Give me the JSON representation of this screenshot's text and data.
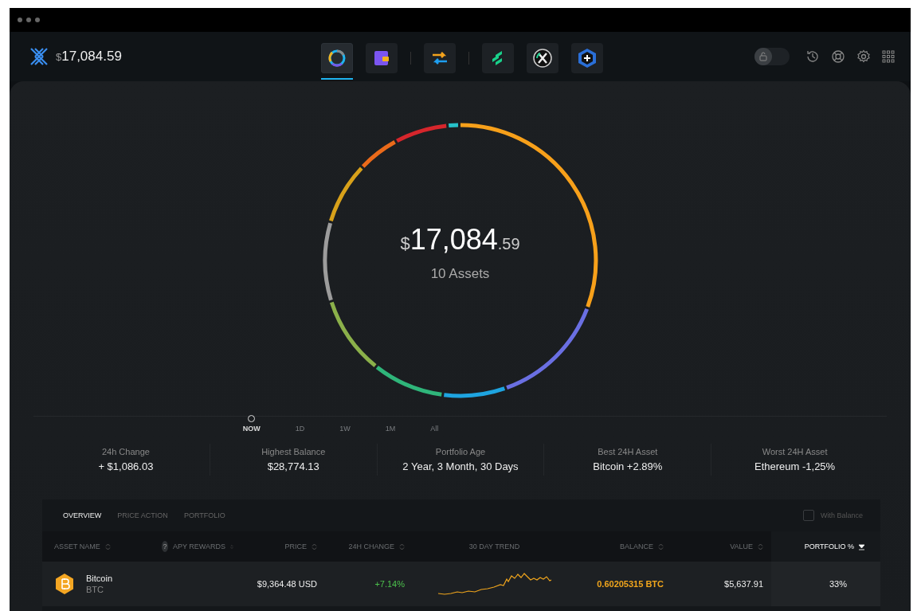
{
  "header": {
    "balance": {
      "currency": "$",
      "amount": "17,084.59"
    },
    "apps": [
      {
        "kind": "portfolio",
        "selected": true
      },
      {
        "kind": "wallet",
        "selected": false
      },
      {
        "kind": "exchange",
        "selected": false
      },
      {
        "kind": "compound",
        "selected": false
      },
      {
        "kind": "xrp",
        "selected": false
      },
      {
        "kind": "hexplus",
        "selected": false
      }
    ],
    "lock_toggle": {
      "on": false
    }
  },
  "portfolio": {
    "total": {
      "currency": "$",
      "whole": "17,084",
      "cents": ".59"
    },
    "assets_label": "10 Assets"
  },
  "time_range": [
    {
      "label": "NOW",
      "selected": true
    },
    {
      "label": "1D",
      "selected": false
    },
    {
      "label": "1W",
      "selected": false
    },
    {
      "label": "1M",
      "selected": false
    },
    {
      "label": "All",
      "selected": false
    }
  ],
  "stats": [
    {
      "label": "24h Change",
      "value": "+ $1,086.03"
    },
    {
      "label": "Highest Balance",
      "value": "$28,774.13"
    },
    {
      "label": "Portfolio Age",
      "value": "2 Year, 3 Month, 30 Days"
    },
    {
      "label": "Best 24H Asset",
      "value": "Bitcoin +2.89%"
    },
    {
      "label": "Worst 24H Asset",
      "value": "Ethereum -1,25%"
    }
  ],
  "table": {
    "tabs": [
      {
        "label": "OVERVIEW",
        "selected": true
      },
      {
        "label": "PRICE ACTION",
        "selected": false
      },
      {
        "label": "PORTFOLIO",
        "selected": false
      }
    ],
    "with_balance": {
      "label": "With Balance",
      "checked": false
    },
    "columns": [
      {
        "label": "ASSET NAME",
        "sorted": false,
        "help": false
      },
      {
        "label": "APY REWARDS",
        "sorted": false,
        "help": "?"
      },
      {
        "label": "PRICE",
        "sorted": false,
        "help": false
      },
      {
        "label": "24H CHANGE",
        "sorted": false,
        "help": false
      },
      {
        "label": "30 DAY TREND",
        "sortable": false
      },
      {
        "label": "BALANCE",
        "sorted": false,
        "help": false
      },
      {
        "label": "VALUE",
        "sorted": false,
        "help": false
      },
      {
        "label": "PORTFOLIO %",
        "sorted": true,
        "help": false
      }
    ],
    "rows": [
      {
        "name": "Bitcoin",
        "ticker": "BTC",
        "price": "$9,364.48 USD",
        "change": "+7.14%",
        "balance": "0.60205315 BTC",
        "value": "$5,637.91",
        "portfolio": "33%"
      }
    ]
  }
}
